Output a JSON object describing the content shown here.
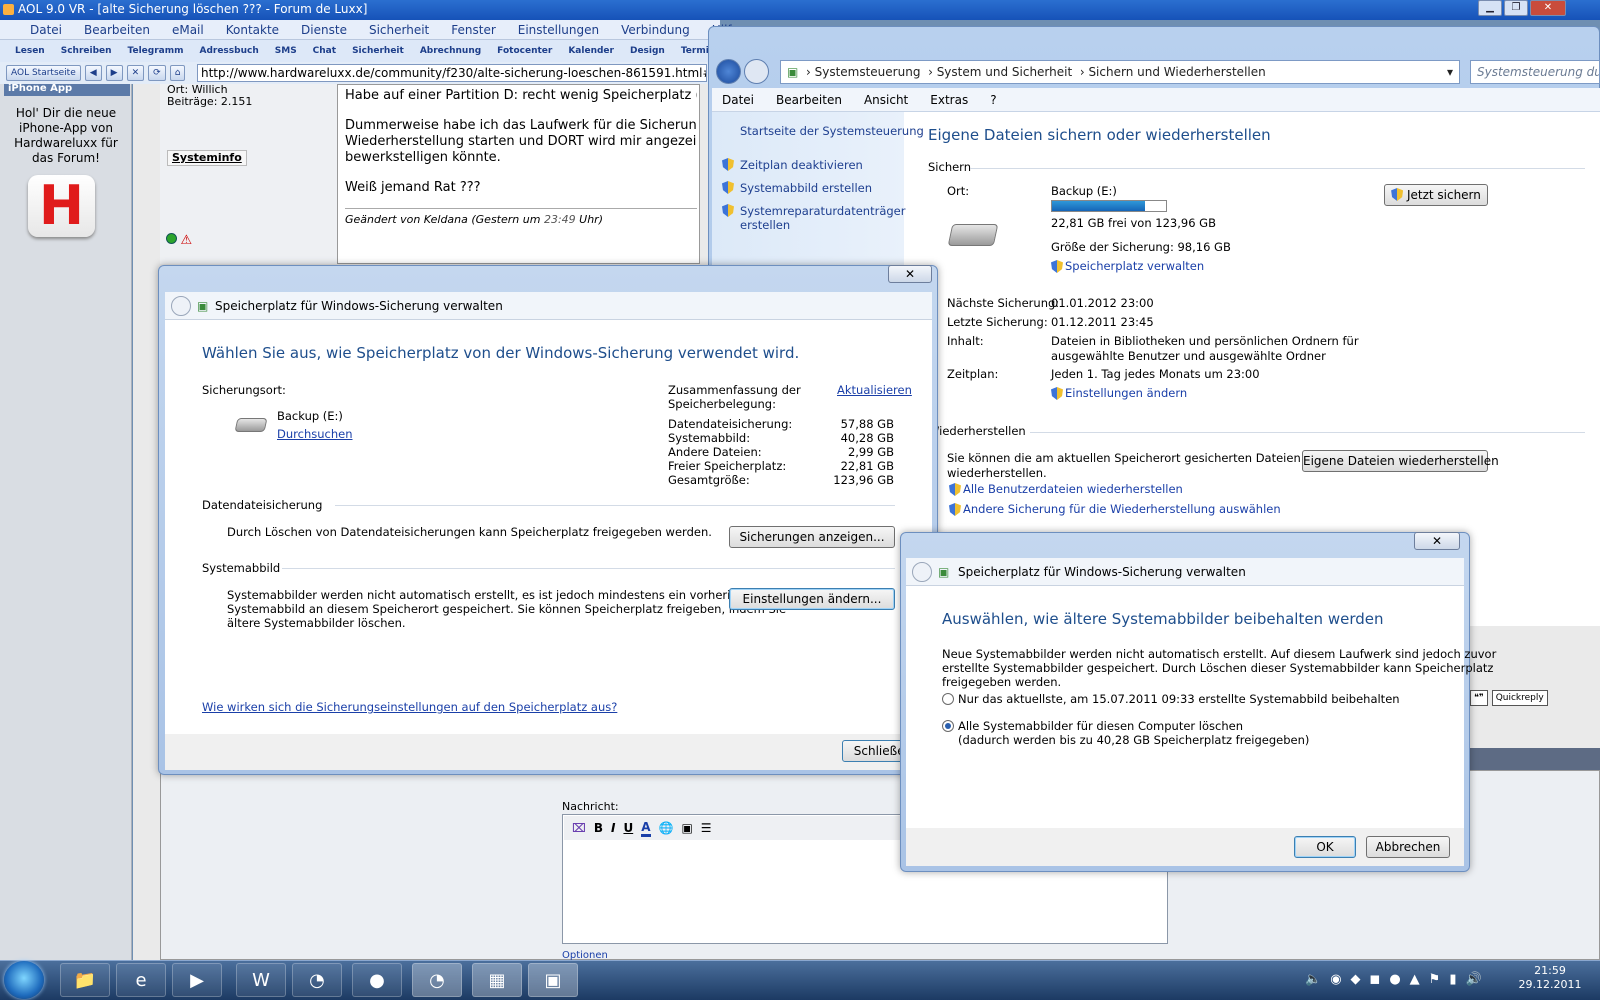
{
  "aol": {
    "title": "AOL 9.0 VR - [alte Sicherung löschen ??? - Forum de Luxx]",
    "menu": [
      "Datei",
      "Bearbeiten",
      "eMail",
      "Kontakte",
      "Dienste",
      "Sicherheit",
      "Fenster",
      "Einstellungen",
      "Verbindung",
      "Hilfe"
    ],
    "toolbar": [
      "Lesen",
      "Schreiben",
      "Telegramm",
      "Adressbuch",
      "SMS",
      "Chat",
      "Sicherheit",
      "Abrechnung",
      "Fotocenter",
      "Kalender",
      "Design",
      "Termin"
    ],
    "home_button": "AOL Startseite",
    "url": "http://www.hardwareluxx.de/community/f230/alte-sicherung-loeschen-861591.html#post1814",
    "left_panel": {
      "header": "iPhone App",
      "text": "Hol' Dir die neue iPhone-App von Hardwareluxx für das Forum!",
      "logo_letter": "H"
    }
  },
  "forum": {
    "ort": "Ort: Willich",
    "beitraege": "Beiträge: 2.151",
    "systeminfo": "Systeminfo",
    "post_lines": [
      "Habe auf einer Partition D: recht wenig Speicherplatz (kle",
      "Dummerweise habe ich das Laufwerk für die Sicherungen",
      "Wiederherstellung starten und DORT wird mir angezeigt,",
      "bewerkstelligen könnte.",
      "Weiß jemand Rat ???"
    ],
    "edited_prefix": "Geändert von Keldana (Gestern um ",
    "edited_time": "23:49",
    "edited_suffix": " Uhr)",
    "nachricht_label": "Nachricht:",
    "optionen": "Optionen",
    "quickreply": "Quickreply"
  },
  "control_panel": {
    "breadcrumb": [
      "Systemsteuerung",
      "System und Sicherheit",
      "Sichern und Wiederherstellen"
    ],
    "search_placeholder": "Systemsteuerung durchsuchen",
    "menu": [
      "Datei",
      "Bearbeiten",
      "Ansicht",
      "Extras",
      "?"
    ],
    "side_home": "Startseite der Systemsteuerung",
    "side_links": [
      "Zeitplan deaktivieren",
      "Systemabbild erstellen",
      "Systemreparaturdatenträger erstellen"
    ],
    "heading": "Eigene Dateien sichern oder wiederherstellen",
    "section_backup": "Sichern",
    "ort_label": "Ort:",
    "drive_name": "Backup (E:)",
    "drive_used_fraction": 0.816,
    "free_text": "22,81 GB frei von 123,96 GB",
    "backup_size": "Größe der Sicherung: 98,16 GB",
    "manage_space": "Speicherplatz verwalten",
    "backup_now": "Jetzt sichern",
    "next_label": "Nächste Sicherung:",
    "next_value": "01.01.2012 23:00",
    "last_label": "Letzte Sicherung:",
    "last_value": "01.12.2011 23:45",
    "content_label": "Inhalt:",
    "content_value": [
      "Dateien in Bibliotheken und persönlichen Ordnern für",
      "ausgewählte Benutzer und ausgewählte Ordner"
    ],
    "schedule_label": "Zeitplan:",
    "schedule_value": "Jeden 1. Tag jedes Monats um 23:00",
    "change_settings": "Einstellungen ändern",
    "section_restore": "Wiederherstellen",
    "restore_text": [
      "Sie können die am aktuellen Speicherort gesicherten Dateien",
      "wiederherstellen."
    ],
    "restore_button": "Eigene Dateien wiederherstellen",
    "restore_all": "Alle Benutzerdateien wiederherstellen",
    "restore_other": "Andere Sicherung für die Wiederherstellung auswählen"
  },
  "dialog1": {
    "title": "Speicherplatz für Windows-Sicherung verwalten",
    "heading": "Wählen Sie aus, wie Speicherplatz von der Windows-Sicherung verwendet wird.",
    "location_label": "Sicherungsort:",
    "drive": "Backup (E:)",
    "browse": "Durchsuchen",
    "summary_label": [
      "Zusammenfassung der",
      "Speicherbelegung:"
    ],
    "refresh": "Aktualisieren",
    "usage": [
      {
        "label": "Datendateisicherung:",
        "value": "57,88 GB"
      },
      {
        "label": "Systemabbild:",
        "value": "40,28 GB"
      },
      {
        "label": "Andere Dateien:",
        "value": "2,99 GB"
      },
      {
        "label": "Freier Speicherplatz:",
        "value": "22,81 GB"
      },
      {
        "label": "Gesamtgröße:",
        "value": "123,96 GB"
      }
    ],
    "data_section": "Datendateisicherung",
    "data_text": "Durch Löschen von Datendateisicherungen kann Speicherplatz freigegeben werden.",
    "show_backups": "Sicherungen anzeigen...",
    "image_section": "Systemabbild",
    "image_text": [
      "Systemabbilder werden nicht automatisch erstellt, es ist jedoch mindestens ein vorheriges",
      "Systemabbild an diesem Speicherort gespeichert. Sie können Speicherplatz freigeben, indem Sie",
      "ältere Systemabbilder löschen."
    ],
    "change_settings": "Einstellungen ändern...",
    "help_link": "Wie wirken sich die Sicherungseinstellungen auf den Speicherplatz aus?",
    "close": "Schließen"
  },
  "dialog2": {
    "title": "Speicherplatz für Windows-Sicherung verwalten",
    "heading": "Auswählen, wie ältere Systemabbilder beibehalten werden",
    "text": [
      "Neue Systemabbilder werden nicht automatisch erstellt. Auf diesem Laufwerk sind jedoch zuvor",
      "erstellte Systemabbilder gespeichert. Durch Löschen dieser Systemabbilder kann Speicherplatz",
      "freigegeben werden."
    ],
    "option1": "Nur das aktuellste, am 15.07.2011 09:33 erstellte Systemabbild beibehalten",
    "option2": [
      "Alle Systemabbilder für diesen Computer löschen",
      "(dadurch werden bis zu 40,28 GB Speicherplatz freigegeben)"
    ],
    "selected": 2,
    "ok": "OK",
    "cancel": "Abbrechen"
  },
  "taskbar": {
    "time": "21:59",
    "date": "29.12.2011"
  }
}
